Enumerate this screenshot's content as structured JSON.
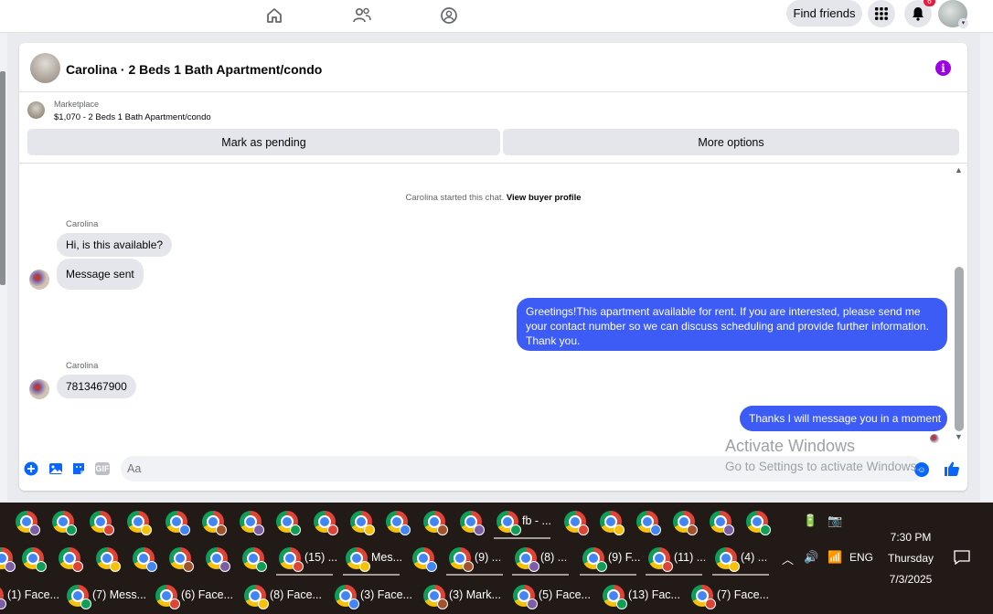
{
  "topbar": {
    "find_friends": "Find friends",
    "notification_count": "6",
    "icons": [
      "home-icon",
      "friends-icon",
      "groups-icon",
      "menu-grid-icon",
      "bell-icon"
    ]
  },
  "conversation": {
    "title": "Carolina · 2 Beds 1 Bath Apartment/condo",
    "listing": {
      "source": "Marketplace",
      "price_title": "$1,070 - 2 Beds 1 Bath Apartment/condo",
      "mark_pending": "Mark as pending",
      "more_options": "More options"
    },
    "started_text": "Carolina started this chat. ",
    "view_buyer": "View buyer profile",
    "messages": [
      {
        "sender": "Carolina",
        "text": "Hi, is this available?"
      },
      {
        "text": "Message sent"
      },
      {
        "outgoing": true,
        "text": "Greetings!This  apartment available for rent. If you are interested, please send me your contact number so we can discuss scheduling and provide further information. Thank you."
      },
      {
        "sender": "Carolina",
        "text": "7813467900"
      },
      {
        "outgoing": true,
        "text": "Thanks I will message you in a moment"
      }
    ],
    "composer": {
      "placeholder": "Aa",
      "gif_label": "GIF"
    }
  },
  "watermark": {
    "title": "Activate Windows",
    "subtitle": "Go to Settings to activate Windows."
  },
  "taskbar": {
    "row1_labels": [
      "fb - ..."
    ],
    "row2_labels": [
      "(15) ...",
      "Mes...",
      "(9) ...",
      "(8) ...",
      "(9) F...",
      "(11) ...",
      "(4) ..."
    ],
    "row3_labels": [
      "(1) Face...",
      "(7) Mess...",
      "(6) Face...",
      "(8) Face...",
      "(3) Face...",
      "(3) Mark...",
      "(5) Face...",
      "(13) Fac...",
      "(7) Face..."
    ],
    "language": "ENG",
    "time": "7:30 PM",
    "day": "Thursday",
    "date": "7/3/2025"
  },
  "colors": {
    "outgoing_bubble": "#3d5cf5",
    "incoming_bubble": "#e4e6eb",
    "info_icon": "#9b00e8",
    "accent": "#0866ff"
  }
}
